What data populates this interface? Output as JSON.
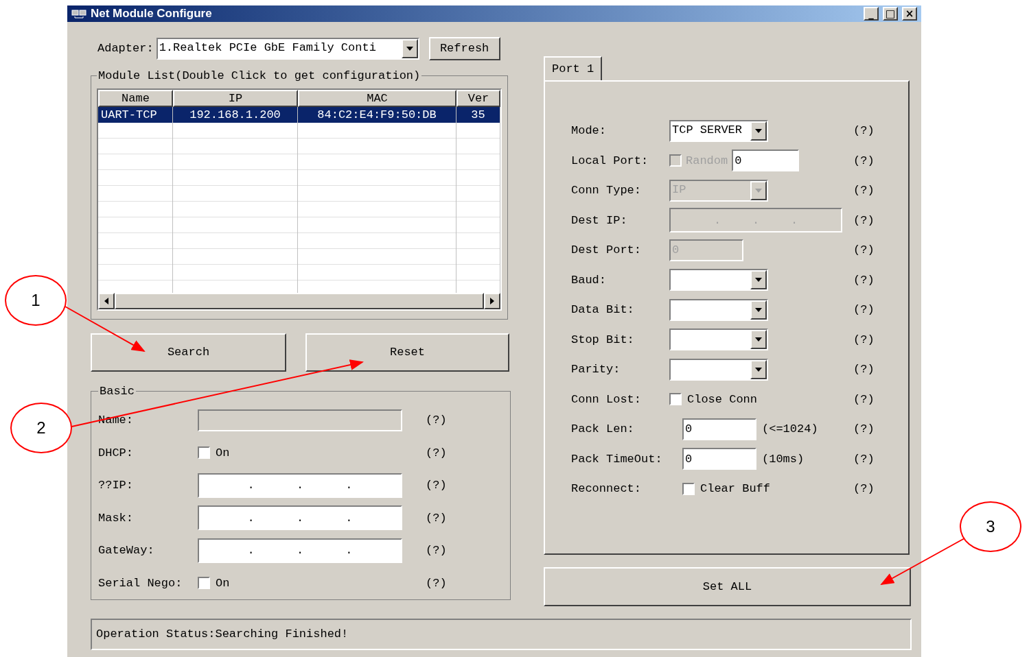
{
  "window": {
    "title": "Net Module Configure",
    "controls": [
      "_",
      "□",
      "×"
    ]
  },
  "adapter": {
    "label": "Adapter:",
    "value": "1.Realtek PCIe GbE Family Conti",
    "refresh": "Refresh"
  },
  "module_list": {
    "title": "Module List(Double Click to get configuration)",
    "columns": [
      "Name",
      "IP",
      "MAC",
      "Ver"
    ],
    "rows": [
      {
        "cells": [
          "UART-TCP",
          "192.168.1.200",
          "84:C2:E4:F9:50:DB",
          "35"
        ],
        "selected": true
      }
    ]
  },
  "buttons": [
    "Search",
    "Reset"
  ],
  "basic": {
    "title": "Basic",
    "fields": [
      {
        "kind": "input",
        "label": "Name:",
        "disabled": true,
        "help": "(?)"
      },
      {
        "kind": "check",
        "label": "DHCP:",
        "check_label": "On",
        "checked": false,
        "help": "(?)"
      },
      {
        "kind": "ip",
        "label": "??IP:",
        "separators": [
          ".",
          ".",
          "."
        ],
        "disabled": false,
        "help": "(?)"
      },
      {
        "kind": "ip",
        "label": "Mask:",
        "separators": [
          ".",
          ".",
          "."
        ],
        "disabled": false,
        "help": "(?)"
      },
      {
        "kind": "ip",
        "label": "GateWay:",
        "separators": [
          ".",
          ".",
          "."
        ],
        "disabled": false,
        "help": "(?)"
      },
      {
        "kind": "check",
        "label": "Serial Nego:",
        "check_label": "On",
        "checked": false,
        "help": "(?)"
      }
    ]
  },
  "port": {
    "tab": {
      "label": "Port 1",
      "selected": true
    },
    "fields": [
      {
        "kind": "select",
        "label": "Mode:",
        "value": "TCP SERVER",
        "disabled": false,
        "help": "(?)"
      },
      {
        "kind": "check_input",
        "label": "Local Port:",
        "check_label": "Random",
        "checked": false,
        "check_disabled": true,
        "value": "0",
        "help": "(?)"
      },
      {
        "kind": "select",
        "label": "Conn Type:",
        "value": "IP",
        "disabled": true,
        "help": "(?)"
      },
      {
        "kind": "ip",
        "label": "Dest IP:",
        "separators": [
          ".",
          ".",
          "."
        ],
        "disabled": true,
        "help": "(?)"
      },
      {
        "kind": "input",
        "label": "Dest Port:",
        "value": "0",
        "disabled": true,
        "help": "(?)"
      },
      {
        "kind": "select",
        "label": "Baud:",
        "disabled": false,
        "help": "(?)"
      },
      {
        "kind": "select",
        "label": "Data Bit:",
        "disabled": false,
        "help": "(?)"
      },
      {
        "kind": "select",
        "label": "Stop Bit:",
        "disabled": false,
        "help": "(?)"
      },
      {
        "kind": "select",
        "label": "Parity:",
        "disabled": false,
        "help": "(?)"
      },
      {
        "kind": "check",
        "label": "Conn Lost:",
        "check_label": "Close Conn",
        "checked": false,
        "help": "(?)"
      },
      {
        "kind": "input",
        "label": "Pack Len:",
        "value": "0",
        "suffix": "(<=1024)",
        "disabled": false,
        "help": "(?)"
      },
      {
        "kind": "input",
        "label": "Pack TimeOut:",
        "value": "0",
        "suffix": "(10ms)",
        "disabled": false,
        "help": "(?)"
      },
      {
        "kind": "check",
        "label": "Reconnect:",
        "check_label": "Clear Buff",
        "checked": false,
        "help": "(?)"
      }
    ]
  },
  "set_all": "Set ALL",
  "status_bar": "Operation Status:Searching Finished!",
  "annotations": [
    {
      "label": "1"
    },
    {
      "label": "2"
    },
    {
      "label": "3"
    }
  ]
}
